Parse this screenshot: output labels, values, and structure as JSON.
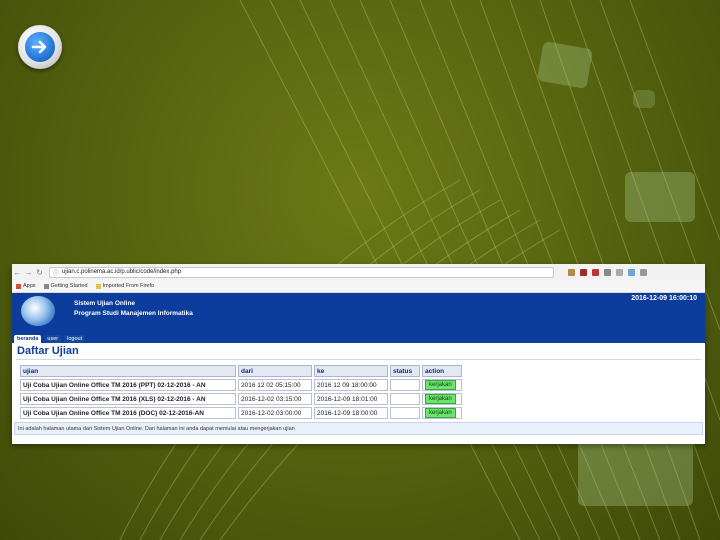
{
  "browser": {
    "url": "ujian.c.polinema.ac.id/p.ublic/code/index.php",
    "bookmarks": [
      "Apps",
      "Getting Started",
      "Imported From Firefo"
    ]
  },
  "app": {
    "name_line1": "Sistem Ujian Online",
    "name_line2": "Program Studi Manajemen Informatika",
    "clock": "2016-12-09 16:00:10",
    "menu": [
      "beranda",
      "user",
      "logout"
    ]
  },
  "page": {
    "title": "Daftar Ujian",
    "columns": [
      "ujian",
      "dari",
      "ke",
      "status",
      "action"
    ],
    "rows": [
      {
        "ujian": "Uji Coba Ujian Online Office TM 2016 (PPT) 02-12-2016 - AN",
        "dari": "2016 12 02 05:15:00",
        "ke": "2016 12 09 18:00:00",
        "status": "",
        "action": "kerjakan"
      },
      {
        "ujian": "Uji Coba Ujian Online Office TM 2016 (XLS) 02-12-2016 - AN",
        "dari": "2016-12-02 03:15:00",
        "ke": "2016-12-09 18:01:00",
        "status": "",
        "action": "kerjakan"
      },
      {
        "ujian": "Uji Coba Ujian Online Office TM 2016 (DOC) 02-12-2016-AN",
        "dari": "2016-12-02 03:00:00",
        "ke": "2016-12-09 18:00:00",
        "status": "",
        "action": "kerjakan"
      }
    ],
    "footer": "Ini adalah halaman utama dari Sistem Ujian Online. Dari halaman ini anda dapat memulai atau mengerjakan ujian"
  },
  "colors": {
    "background": "#57650f",
    "header_blue": "#0c3d9c",
    "action_green": "#6ee26e"
  },
  "icons": [
    "back-icon",
    "forward-icon",
    "reload-icon",
    "lock-icon",
    "arrow-right-icon",
    "globe-logo-icon"
  ]
}
